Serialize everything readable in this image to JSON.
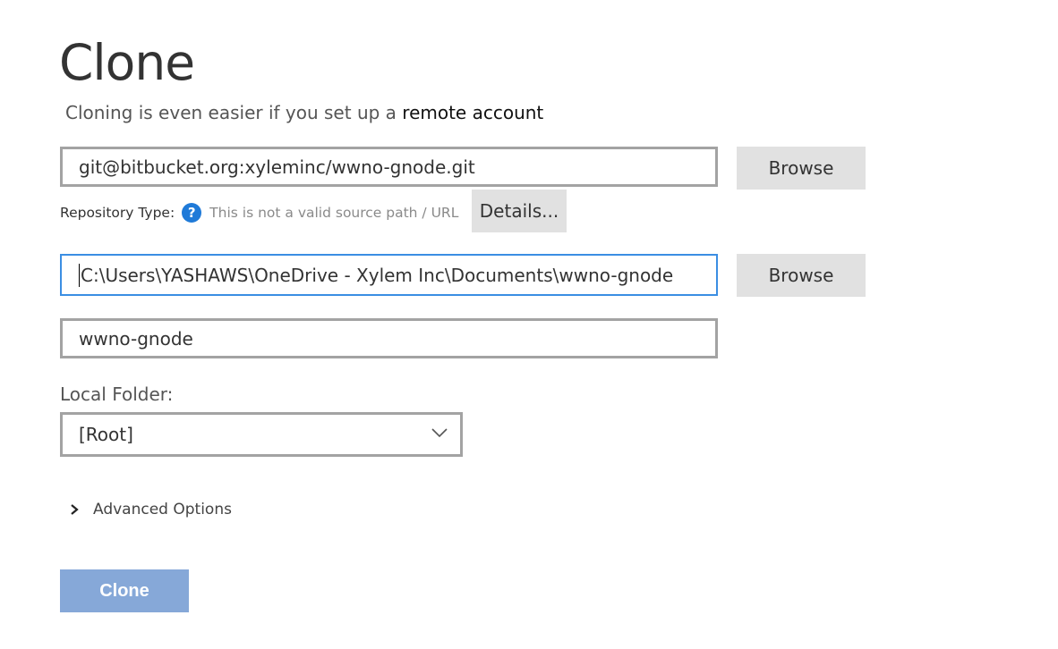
{
  "page": {
    "title": "Clone",
    "subtitle": {
      "prefix": "Cloning is even easier if you set up a",
      "link": "remote account"
    }
  },
  "source": {
    "url_value": "git@bitbucket.org:xyleminc/wwno-gnode.git",
    "browse_label": "Browse"
  },
  "repository_type": {
    "label": "Repository Type:",
    "icon": "question-help-icon",
    "status": "This is not a valid source path / URL",
    "details_label": "Details..."
  },
  "destination": {
    "path_value": "C:\\Users\\YASHAWS\\OneDrive - Xylem Inc\\Documents\\wwno-gnode",
    "browse_label": "Browse"
  },
  "name": {
    "value": "wwno-gnode"
  },
  "local_folder": {
    "label": "Local Folder:",
    "selected": "[Root]"
  },
  "advanced": {
    "label": "Advanced Options"
  },
  "actions": {
    "clone_label": "Clone"
  },
  "colors": {
    "accent_focus": "#3b8ee3",
    "help_icon": "#1f7ad8",
    "clone_button_disabled": "#86a8d8",
    "button_bg": "#e1e1e1",
    "field_border": "#a3a3a3"
  }
}
